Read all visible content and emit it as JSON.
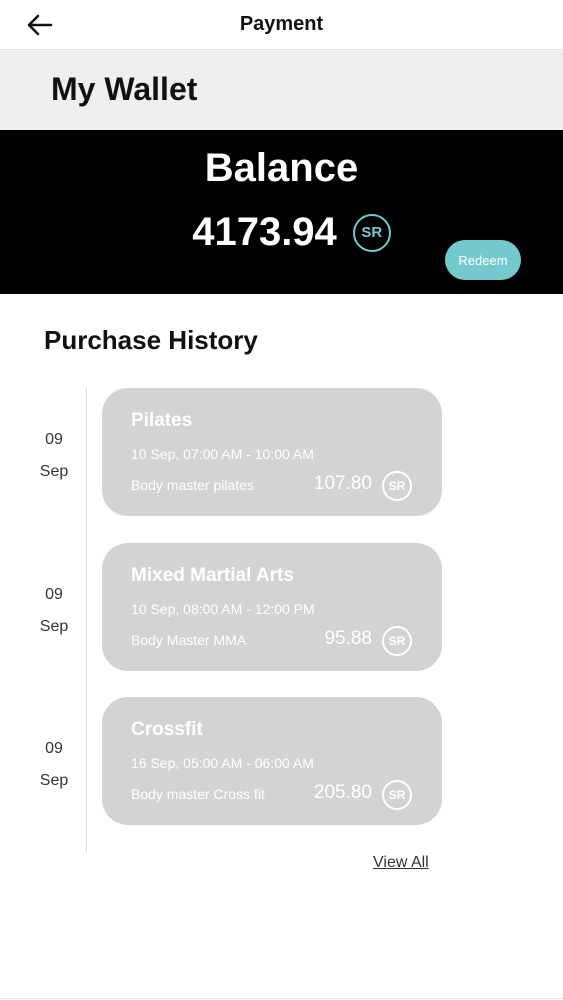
{
  "header": {
    "title": "Payment",
    "back_icon": "arrow-left-icon"
  },
  "wallet": {
    "title": "My Wallet"
  },
  "balance": {
    "label": "Balance",
    "amount": "4173.94",
    "currency": "SR",
    "redeem_label": "Redeem",
    "accent_color": "#74c9cc"
  },
  "history": {
    "title": "Purchase History",
    "items": [
      {
        "day": "09",
        "month": "Sep",
        "title": "Pilates",
        "time": "10 Sep, 07:00 AM - 10:00 AM",
        "venue": "Body master pilates",
        "price": "107.80",
        "currency": "SR"
      },
      {
        "day": "09",
        "month": "Sep",
        "title": "Mixed Martial Arts",
        "time": "10 Sep, 08:00 AM - 12:00 PM",
        "venue": "Body Master MMA",
        "price": "95.88",
        "currency": "SR"
      },
      {
        "day": "09",
        "month": "Sep",
        "title": "Crossfit",
        "time": "16 Sep, 05:00 AM - 06:00 AM",
        "venue": "Body master Cross fit",
        "price": "205.80",
        "currency": "SR"
      }
    ],
    "view_all_label": "View All"
  }
}
